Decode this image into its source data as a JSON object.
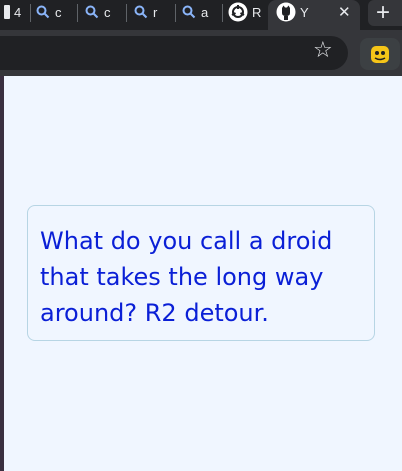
{
  "browser": {
    "tabs": [
      {
        "label": "4",
        "icon": "window-icon"
      },
      {
        "label": "c",
        "icon": "search-icon"
      },
      {
        "label": "c",
        "icon": "search-icon"
      },
      {
        "label": "r",
        "icon": "search-icon"
      },
      {
        "label": "a",
        "icon": "search-icon"
      },
      {
        "label": "R",
        "icon": "openai-icon"
      },
      {
        "label": "Y",
        "icon": "github-icon"
      }
    ],
    "close_glyph": "✕",
    "new_tab_glyph": "+",
    "bookmark_glyph": "☆",
    "extension_icon": "extension-avatar-icon"
  },
  "popup": {
    "joke": "What do you call a droid that takes the long way around? R2 detour."
  },
  "colors": {
    "popup_bg": "#f0f6ff",
    "card_border": "#b7d5e4",
    "joke_text": "#0a1fd6"
  }
}
